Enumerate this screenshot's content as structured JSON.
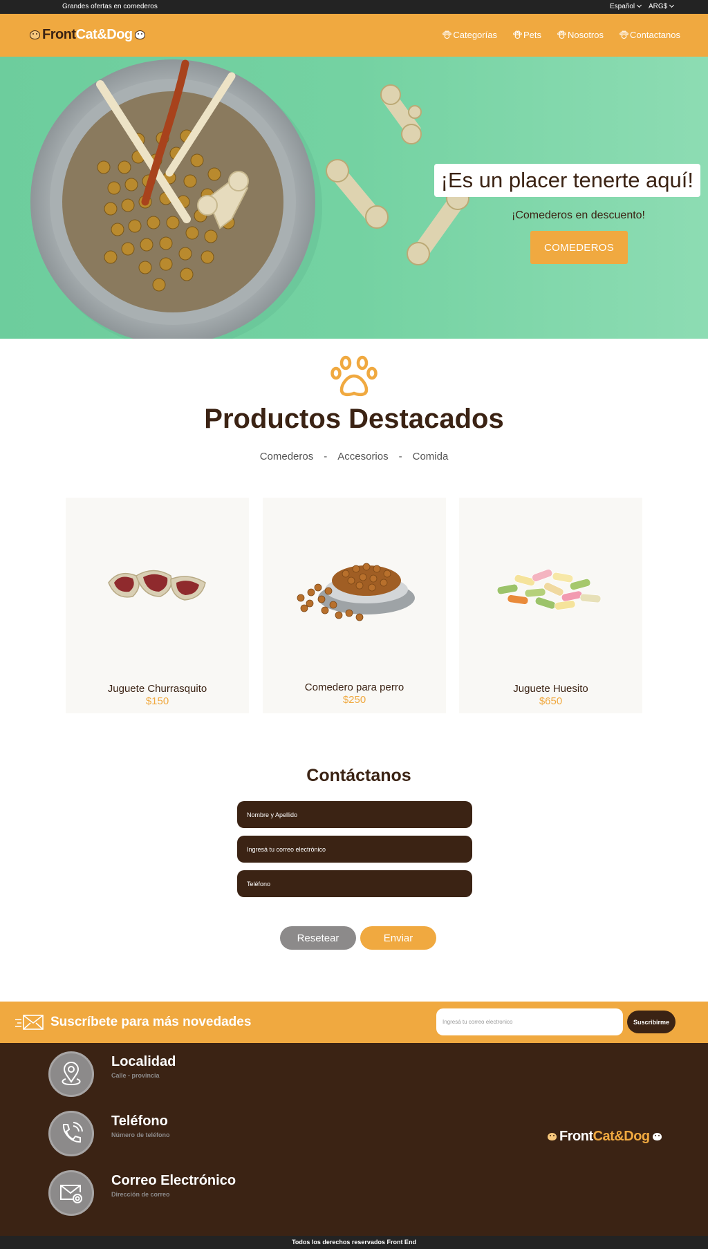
{
  "topbar": {
    "promo": "Grandes ofertas en comederos",
    "language": "Español",
    "currency": "ARG$"
  },
  "header": {
    "logo_front": "Front",
    "logo_catdog": "Cat&Dog",
    "nav": [
      {
        "label": "Categorías",
        "icon": "paw-icon"
      },
      {
        "label": "Pets",
        "icon": "paw-icon"
      },
      {
        "label": "Nosotros",
        "icon": "paw-icon"
      },
      {
        "label": "Contactanos",
        "icon": "paw-icon"
      }
    ]
  },
  "hero": {
    "title": "¡Es un placer tenerte aquí!",
    "subtitle": "¡Comederos en descuento!",
    "button": "COMEDEROS"
  },
  "featured": {
    "title": "Productos Destacados",
    "filters": [
      "Comederos",
      "Accesorios",
      "Comida"
    ],
    "separator": "-",
    "products": [
      {
        "name": "Juguete Churrasquito",
        "price": "$150"
      },
      {
        "name": "Comedero para perro",
        "price": "$250"
      },
      {
        "name": "Juguete Huesito",
        "price": "$650"
      }
    ]
  },
  "contact": {
    "title": "Contáctanos",
    "name_placeholder": "Nombre y Apellido",
    "email_placeholder": "Ingresá tu correo electrónico",
    "phone_placeholder": "Teléfono",
    "reset": "Resetear",
    "send": "Enviar"
  },
  "subscribe": {
    "text": "Suscríbete para más novedades",
    "placeholder": "Ingresá tu correo electronico",
    "button": "Suscribirme"
  },
  "footer": {
    "items": [
      {
        "title": "Localidad",
        "sub": "Calle - provincia",
        "icon": "location-pin-icon"
      },
      {
        "title": "Teléfono",
        "sub": "Número de teléfono",
        "icon": "phone-icon"
      },
      {
        "title": "Correo Electrónico",
        "sub": "Dirección de correo",
        "icon": "mail-icon"
      }
    ],
    "logo_front": "Front",
    "logo_catdog": "Cat&Dog",
    "copyright": "Todos los derechos reservados Front End"
  },
  "colors": {
    "brand_orange": "#f0a940",
    "brand_brown": "#3b2314",
    "hero_green": "#74d2a2",
    "gray": "#8c8a8a"
  }
}
